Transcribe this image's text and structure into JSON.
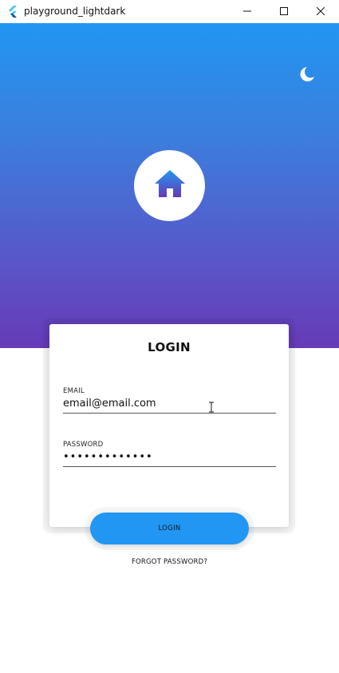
{
  "window": {
    "title": "playground_lightdark",
    "controls": [
      "minimize",
      "maximize",
      "close"
    ]
  },
  "header": {
    "gradient_top": "#2196f3",
    "gradient_bottom": "#673ab7",
    "theme_toggle_icon": "moon-icon",
    "logo_icon": "home-icon"
  },
  "login_card": {
    "title": "LOGIN",
    "email": {
      "label": "EMAIL",
      "value": "email@email.com"
    },
    "password": {
      "label": "PASSWORD",
      "value": "•••••••••••••"
    }
  },
  "actions": {
    "login_label": "LOGIN",
    "login_color": "#2196f3",
    "forgot_label": "FORGOT PASSWORD?"
  }
}
